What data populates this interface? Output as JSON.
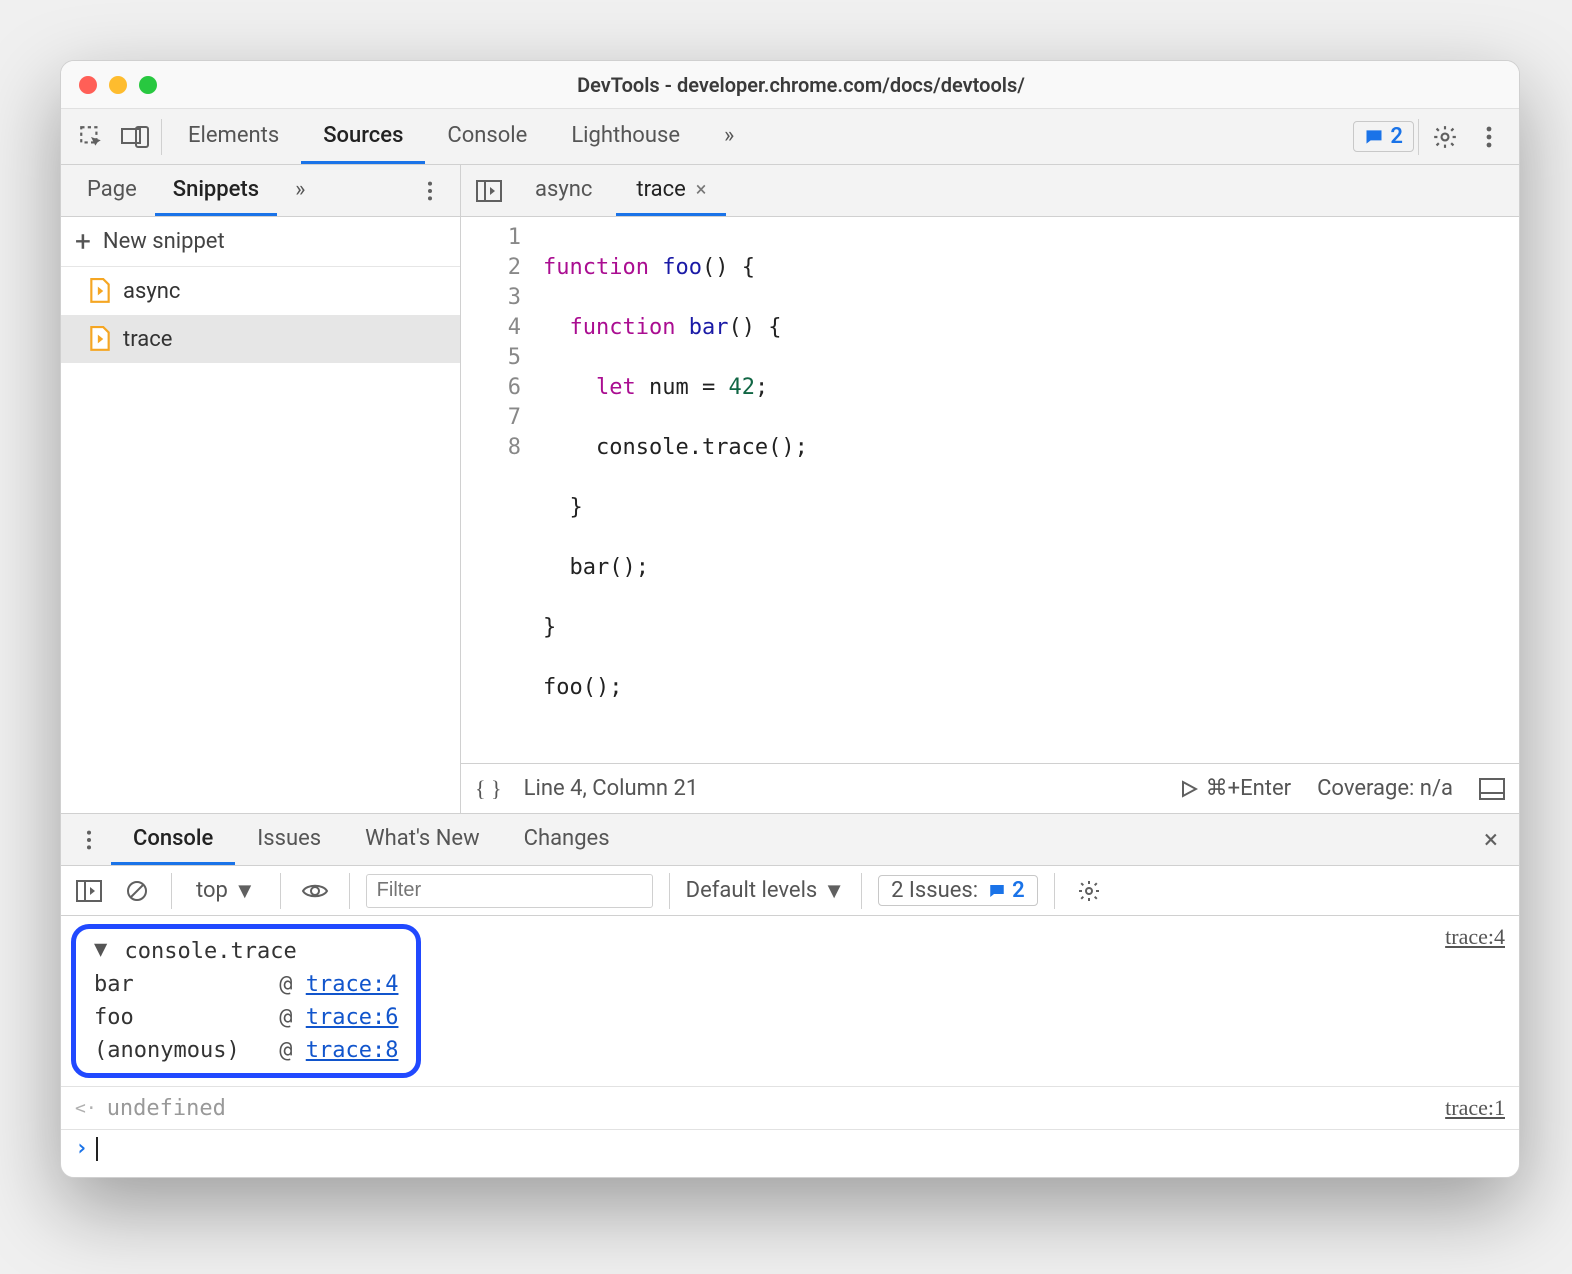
{
  "window": {
    "title": "DevTools - developer.chrome.com/docs/devtools/"
  },
  "mainTabs": {
    "items": [
      "Elements",
      "Sources",
      "Console",
      "Lighthouse"
    ],
    "moreGlyph": "»",
    "issuesCount": "2"
  },
  "sidebar": {
    "tabs": [
      "Page",
      "Snippets"
    ],
    "moreGlyph": "»",
    "newSnippetLabel": "New snippet",
    "items": [
      {
        "name": "async",
        "selected": false
      },
      {
        "name": "trace",
        "selected": true
      }
    ]
  },
  "editor": {
    "tabs": [
      {
        "name": "async",
        "active": false,
        "closeable": false
      },
      {
        "name": "trace",
        "active": true,
        "closeable": true
      }
    ],
    "code": {
      "line1_kw": "function",
      "line1_fn": "foo",
      "line1_rest": "() {",
      "line2_kw": "function",
      "line2_fn": "bar",
      "line2_rest": "() {",
      "line3_kw": "let",
      "line3_var": "num",
      "line3_eq": " = ",
      "line3_num": "42",
      "line3_semi": ";",
      "line4": "console.trace();",
      "line5": "}",
      "line6": "bar();",
      "line7": "}",
      "line8": "foo();"
    },
    "status": {
      "cursor": "Line 4, Column 21",
      "runHint": "⌘+Enter",
      "coverage": "Coverage: n/a"
    }
  },
  "drawer": {
    "tabs": [
      "Console",
      "Issues",
      "What's New",
      "Changes"
    ]
  },
  "consoleToolbar": {
    "context": "top",
    "filterPlaceholder": "Filter",
    "levels": "Default levels",
    "issuesLabel": "2 Issues:",
    "issuesCount": "2"
  },
  "consoleOutput": {
    "traceTitle": "console.trace",
    "sourceLink": "trace:4",
    "stack": [
      {
        "fn": "bar",
        "loc": "trace:4"
      },
      {
        "fn": "foo",
        "loc": "trace:6"
      },
      {
        "fn": "(anonymous)",
        "loc": "trace:8"
      }
    ],
    "returnLine": {
      "value": "undefined",
      "source": "trace:1"
    },
    "promptGlyph": "›"
  }
}
